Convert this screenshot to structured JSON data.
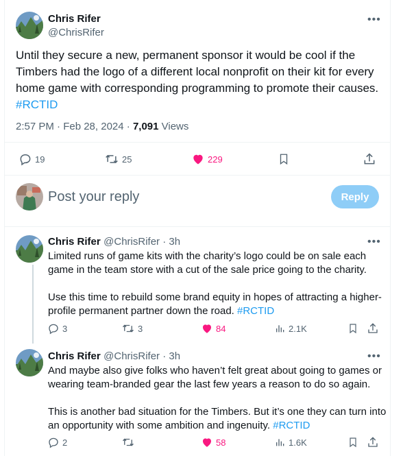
{
  "main_tweet": {
    "author_name": "Chris Rifer",
    "author_handle": "@ChrisRifer",
    "text_lines": [
      "Until they secure a new, permanent sponsor it would be cool if the",
      "Timbers had the logo of a different local nonprofit on their kit for every",
      "home game with corresponding programming to promote their causes."
    ],
    "hashtag": "#RCTID",
    "timestamp": "2:57 PM · Feb 28, 2024 · ",
    "views_count": "7,091",
    "views_label": " Views",
    "actions": {
      "replies": "19",
      "retweets": "25",
      "likes": "229"
    }
  },
  "reply_composer": {
    "placeholder": "Post your reply",
    "button_label": "Reply"
  },
  "replies": [
    {
      "author_name": "Chris Rifer",
      "author_handle": "@ChrisRifer",
      "time": " · 3h",
      "lines": [
        "Limited runs of game kits with the charity’s logo could be on sale each",
        "game in the team store with a cut of the sale price going to the charity.",
        "",
        "Use this time to rebuild some brand equity in hopes of attracting a higher-",
        "profile permanent partner down the road. "
      ],
      "hashtag": "#RCTID",
      "actions": {
        "replies": "3",
        "retweets": "3",
        "likes": "84",
        "views": "2.1K"
      }
    },
    {
      "author_name": "Chris Rifer",
      "author_handle": "@ChrisRifer",
      "time": " · 3h",
      "lines": [
        "And maybe also give folks who haven’t felt great about going to games or",
        "wearing team-branded gear the last few years a reason to do so again.",
        "",
        "This is another bad situation for the Timbers. But it’s one they can turn into",
        "an opportunity with some ambition and ingenuity. "
      ],
      "hashtag": "#RCTID",
      "actions": {
        "replies": "2",
        "retweets": "",
        "likes": "58",
        "views": "1.6K"
      }
    }
  ],
  "colors": {
    "accent": "#1d9bf0",
    "like": "#f91880",
    "muted": "#536471",
    "reply_button": "#8ecdf7"
  }
}
